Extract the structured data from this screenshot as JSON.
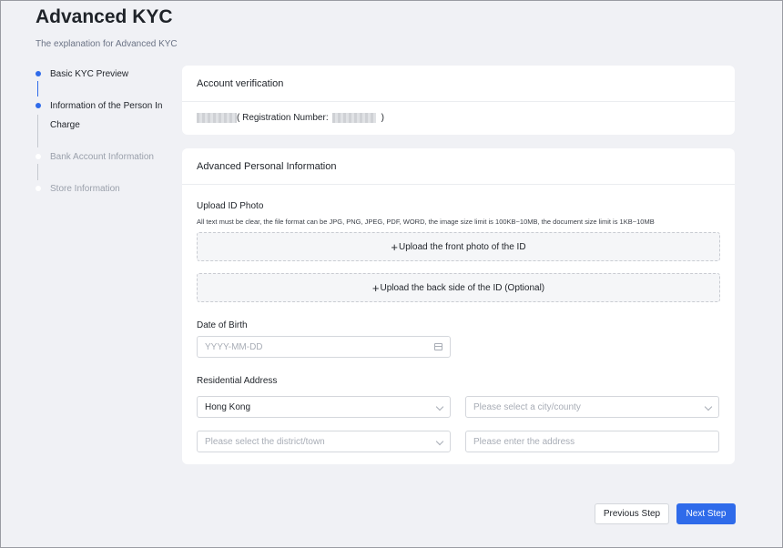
{
  "header": {
    "title": "Advanced KYC",
    "subtitle": "The explanation for Advanced KYC"
  },
  "steps": [
    {
      "label": "Basic KYC Preview",
      "state": "active"
    },
    {
      "label": "Information of the Person In",
      "label2": "Charge",
      "state": "active"
    },
    {
      "label": "Bank Account Information",
      "state": "inactive"
    },
    {
      "label": "Store Information",
      "state": "inactive"
    }
  ],
  "account_verification": {
    "title": "Account verification",
    "reg_prefix": "( Registration Number:",
    "reg_suffix": ")"
  },
  "personal_info": {
    "title": "Advanced Personal Information",
    "upload_label": "Upload ID Photo",
    "upload_hint": "All text must be clear, the file format can be JPG, PNG, JPEG, PDF, WORD, the image size limit is 100KB~10MB, the document size limit is 1KB~10MB",
    "upload_front": "Upload the front photo of the ID",
    "upload_back": "Upload the back side of the ID (Optional)",
    "dob_label": "Date of Birth",
    "dob_placeholder": "YYYY-MM-DD",
    "address_label": "Residential Address",
    "country_value": "Hong Kong",
    "city_placeholder": "Please select a city/county",
    "district_placeholder": "Please select the district/town",
    "address_placeholder": "Please enter the address"
  },
  "footer": {
    "prev_label": "Previous Step",
    "next_label": "Next Step"
  },
  "colors": {
    "accent": "#2f6bea",
    "background": "#f0f1f5"
  }
}
